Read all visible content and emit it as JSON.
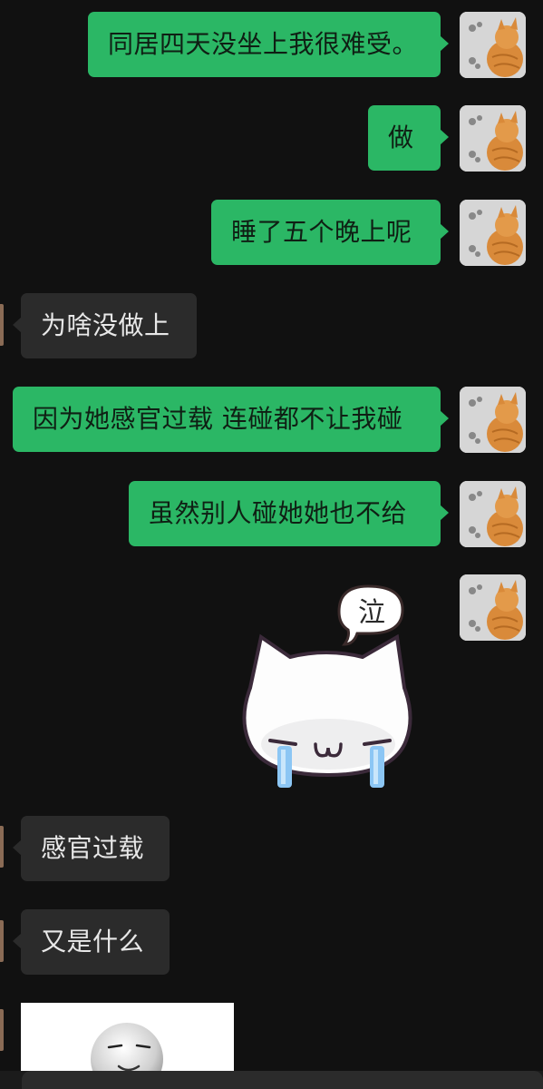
{
  "messages": {
    "m1": "同居四天没坐上我很难受。",
    "m2": "做",
    "m3": "睡了五个晚上呢",
    "m4": "为啥没做上",
    "m5": "因为她感官过载 连碰都不让我碰",
    "m6": "虽然别人碰她她也不给",
    "m7_sticker_text": "泣",
    "m8": "感官过载",
    "m9": "又是什么"
  },
  "colors": {
    "background": "#111111",
    "my_bubble": "#2bb765",
    "their_bubble": "#2b2b2b"
  },
  "icons": {
    "my_avatar": "orange-cat-avatar",
    "sticker": "crying-cat-sticker",
    "image": "smiling-face-image"
  }
}
